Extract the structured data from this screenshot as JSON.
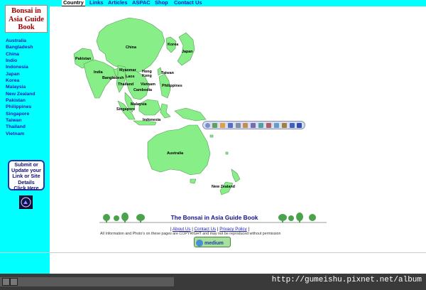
{
  "logo": {
    "line1": "Bonsai in",
    "line2": "Asia Guide",
    "line3": "Book"
  },
  "sidebar": {
    "countries": [
      "Australia",
      "Bangladesh",
      "China",
      "Indio",
      "Indonesia",
      "Japan",
      "Korea",
      "Malaysia",
      "New Zealand",
      "Pakistan",
      "Philippines",
      "Singapore",
      "Taiwan",
      "Thailand",
      "Vietnam"
    ],
    "submit": {
      "line1": "Submit or",
      "line2": "Update your",
      "line3": "Link or Site",
      "line4": "Details",
      "line5": "Click Here"
    }
  },
  "topnav": {
    "tabs": [
      "Country",
      "Links",
      "Articles",
      "ASPAC",
      "Shop",
      "Contact Us"
    ]
  },
  "map": {
    "labels": [
      "China",
      "Korea",
      "Japan",
      "Pakistan",
      "India",
      "Myanmar",
      "Bangladesh",
      "Hong",
      "Kong",
      "Laos",
      "Taiwan",
      "Vietnam",
      "Thailand",
      "Cambodia",
      "Philippines",
      "Malaysia",
      "Singapore",
      "Indonesia",
      "Australia",
      "New Zealand"
    ],
    "colors": {
      "land": "#88ee88",
      "outline": "#5a9a5a"
    }
  },
  "footer": {
    "title": "The Bonsai in Asia Guide Book",
    "sep": "|",
    "links": [
      "About Us",
      "Contact Us",
      "Privacy Policy"
    ],
    "copyright": "All Information and Photo's on these pages are COPYRIGHT and may not be reproduced without permission",
    "badge": "medium"
  },
  "status": {
    "url": "http://gumeishu.pixnet.net/album"
  },
  "colors": {
    "sidebar": "#00ffff",
    "link": "#1a1ab0",
    "title": "#101090"
  }
}
